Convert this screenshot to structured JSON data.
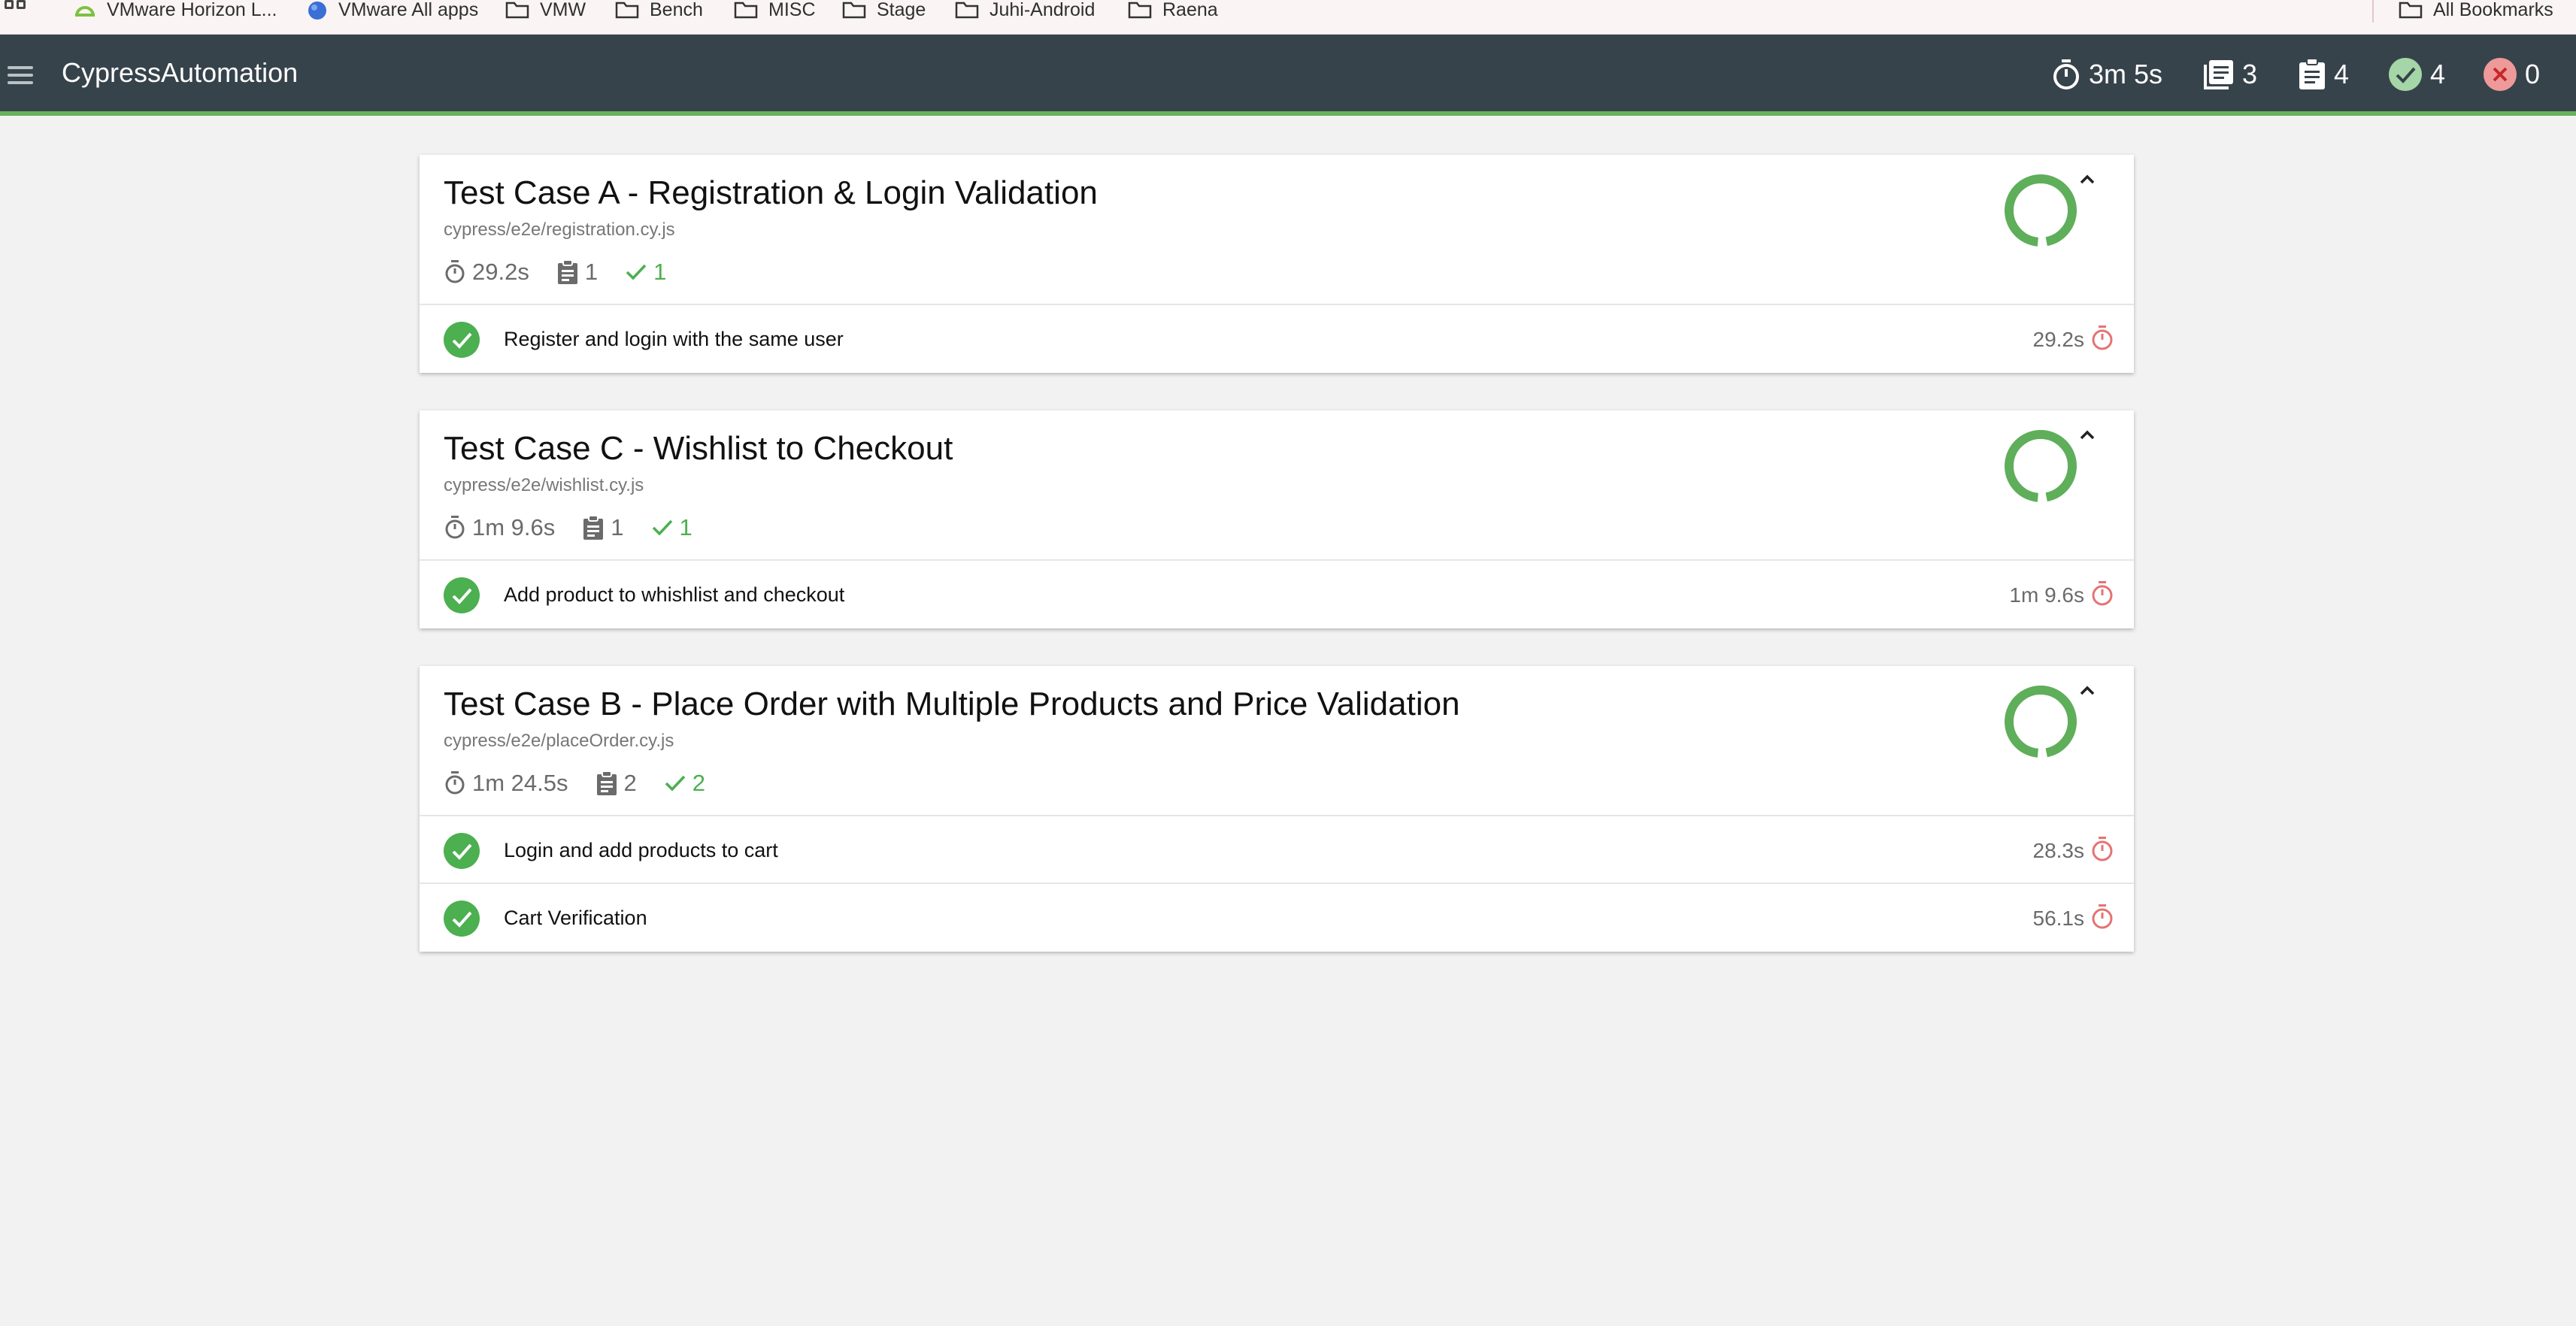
{
  "bookmarks": {
    "items": [
      {
        "label": "VMware Horizon L...",
        "icon": "horizon-icon"
      },
      {
        "label": "VMware All apps",
        "icon": "globe-icon"
      },
      {
        "label": "VMW",
        "icon": "folder-icon"
      },
      {
        "label": "Bench",
        "icon": "folder-icon"
      },
      {
        "label": "MISC",
        "icon": "folder-icon"
      },
      {
        "label": "Stage",
        "icon": "folder-icon"
      },
      {
        "label": "Juhi-Android",
        "icon": "folder-icon"
      },
      {
        "label": "Raena",
        "icon": "folder-icon"
      }
    ],
    "all_bookmarks": "All Bookmarks"
  },
  "topbar": {
    "title": "CypressAutomation",
    "stats": {
      "duration": "3m 5s",
      "suites": "3",
      "tests": "4",
      "passed": "4",
      "failed": "0"
    }
  },
  "colors": {
    "topbar": "#37434b",
    "accent": "#64b25b",
    "pass": "#4caf50",
    "fail": "#e57373"
  },
  "suites": [
    {
      "title": "Test Case A - Registration & Login Validation",
      "file": "cypress/e2e/registration.cy.js",
      "duration": "29.2s",
      "tests_count": "1",
      "passed_count": "1",
      "tests": [
        {
          "title": "Register and login with the same user",
          "duration": "29.2s"
        }
      ]
    },
    {
      "title": "Test Case C - Wishlist to Checkout",
      "file": "cypress/e2e/wishlist.cy.js",
      "duration": "1m 9.6s",
      "tests_count": "1",
      "passed_count": "1",
      "tests": [
        {
          "title": "Add product to whishlist and checkout",
          "duration": "1m 9.6s"
        }
      ]
    },
    {
      "title": "Test Case B - Place Order with Multiple Products and Price Validation",
      "file": "cypress/e2e/placeOrder.cy.js",
      "duration": "1m 24.5s",
      "tests_count": "2",
      "passed_count": "2",
      "tests": [
        {
          "title": "Login and add products to cart",
          "duration": "28.3s"
        },
        {
          "title": "Cart Verification",
          "duration": "56.1s"
        }
      ]
    }
  ]
}
